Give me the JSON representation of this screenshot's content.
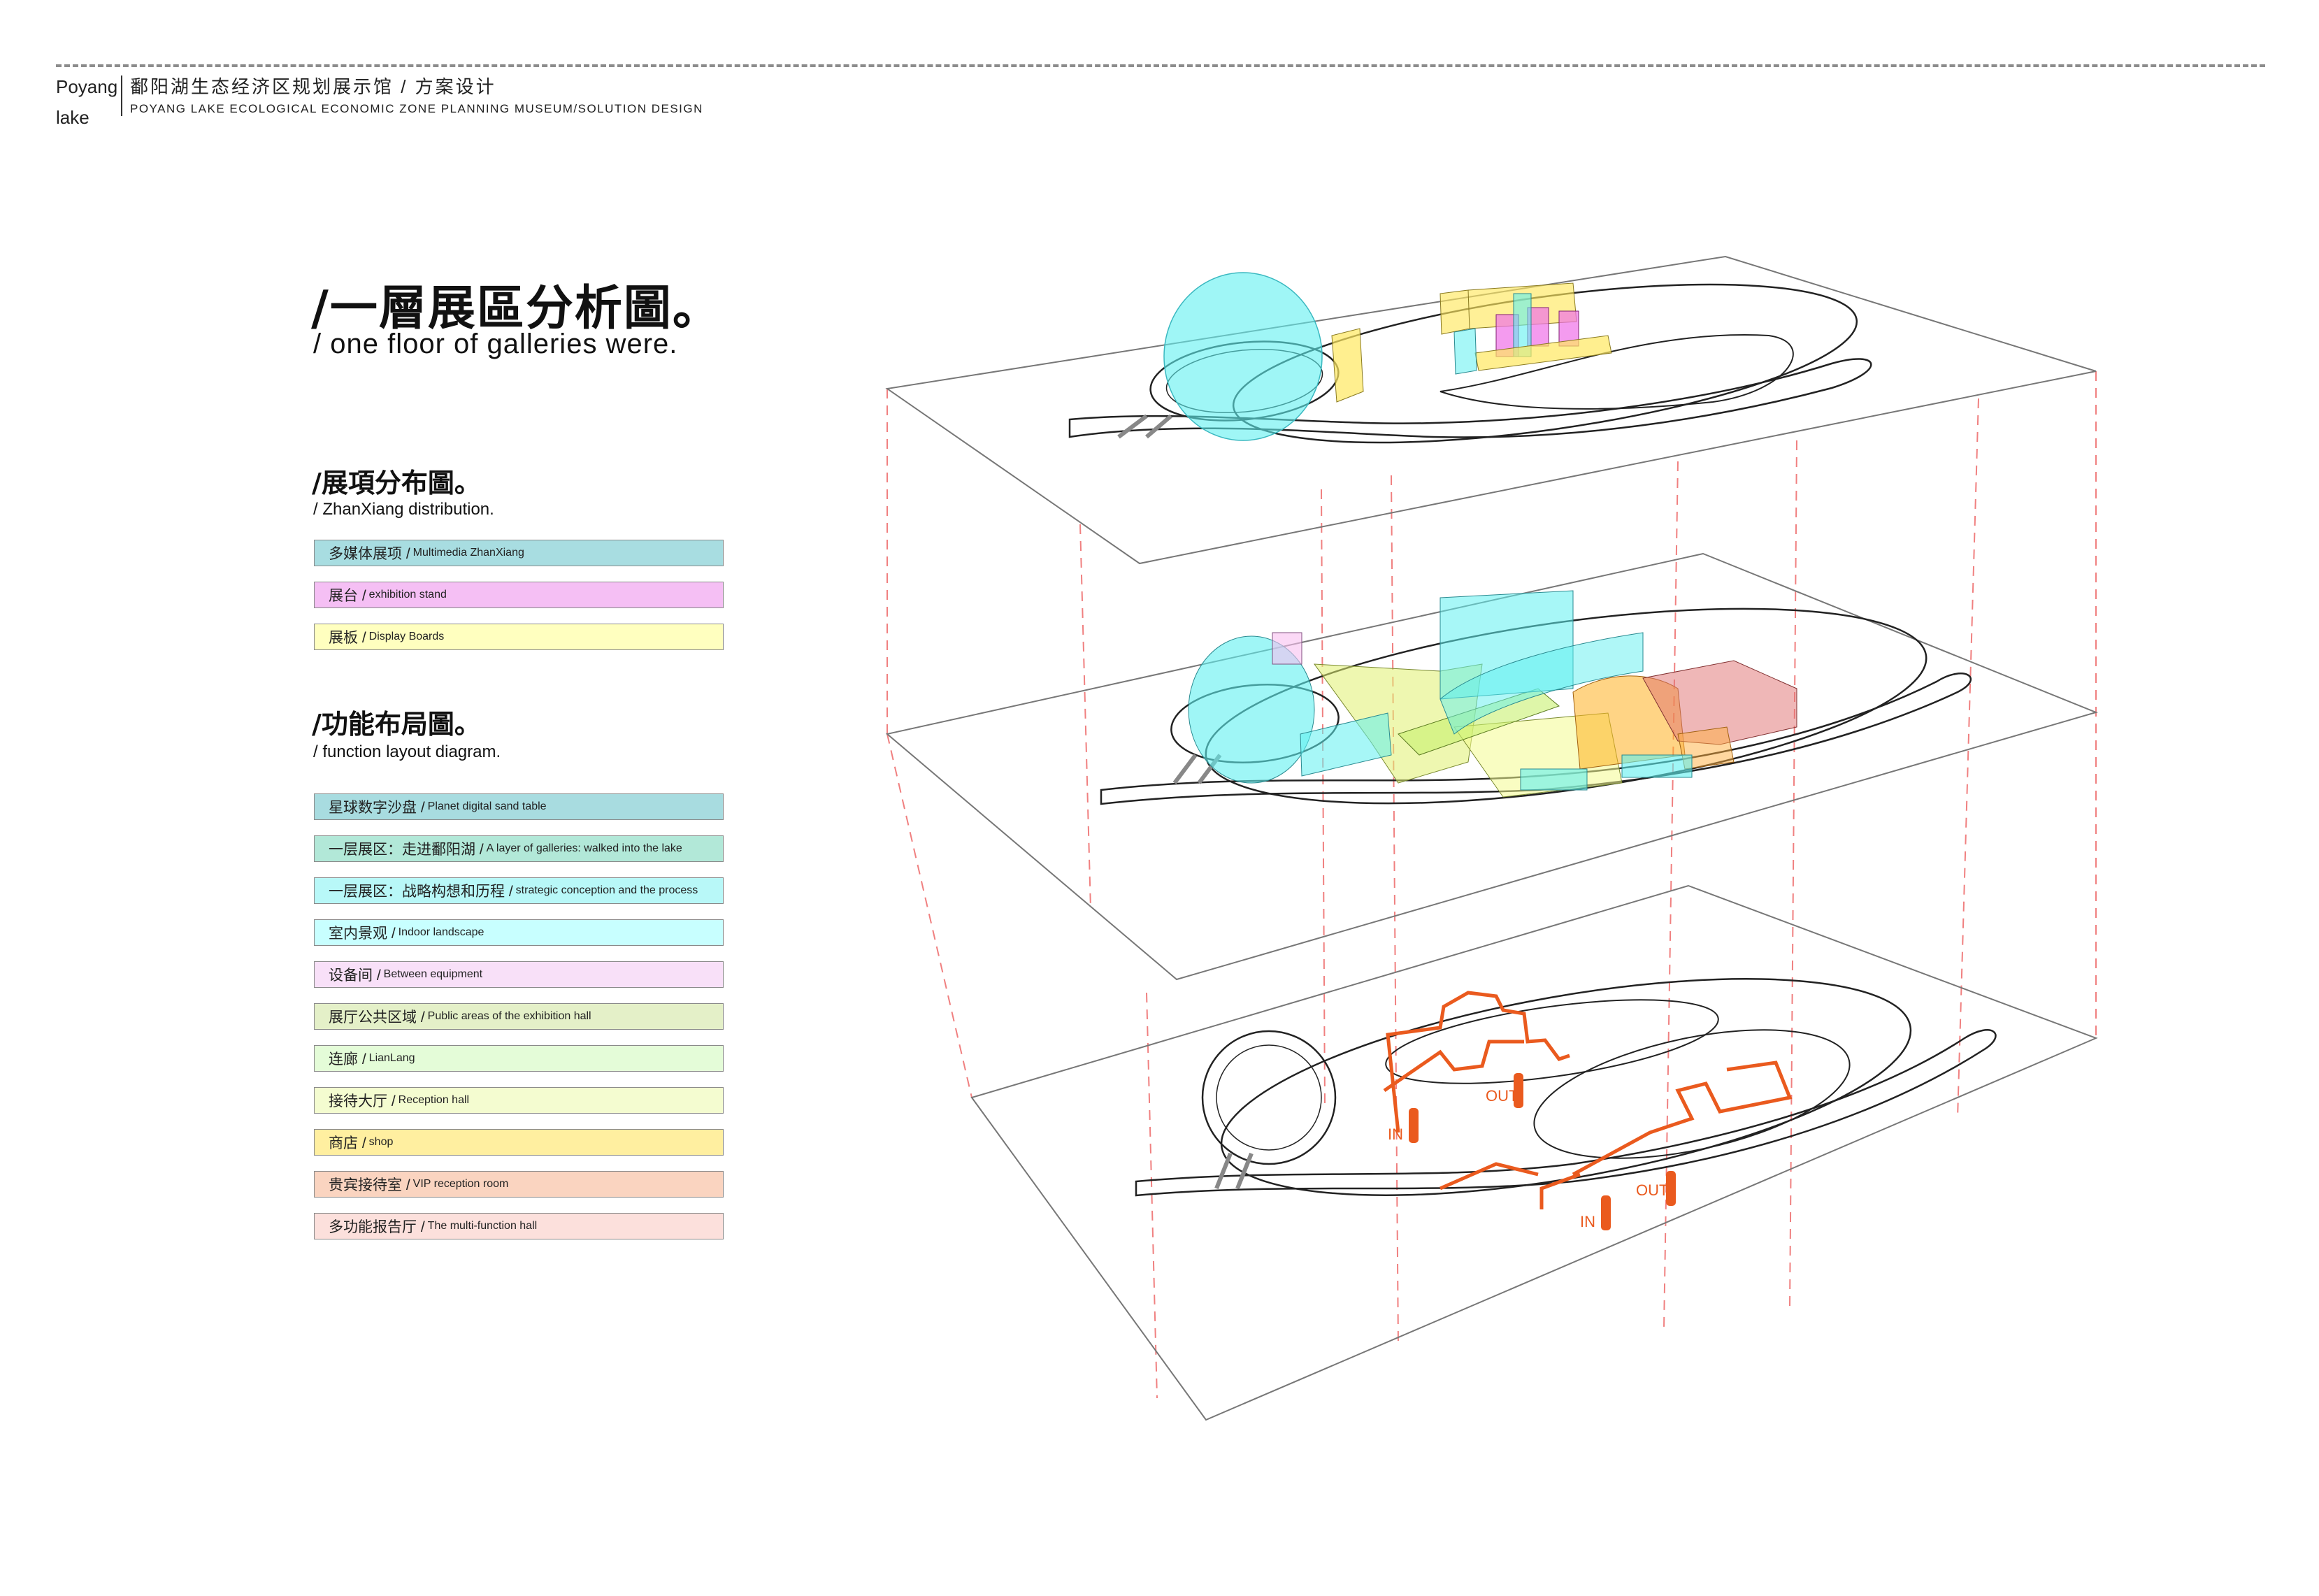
{
  "header": {
    "brand_line1": "Poyang",
    "brand_line2": "lake",
    "title_cn": "鄱阳湖生态经济区规划展示馆 / 方案设计",
    "title_en": "POYANG LAKE ECOLOGICAL ECONOMIC ZONE PLANNING MUSEUM/SOLUTION DESIGN"
  },
  "main_title": {
    "cn": "/一層展區分析圖。",
    "en": "/ one floor of galleries were."
  },
  "zhanxiang_section": {
    "title_cn": "/展項分布圖。",
    "title_en": "/ ZhanXiang distribution.",
    "items": [
      {
        "cn": "多媒体展项 /",
        "en": "Multimedia ZhanXiang",
        "color": "#A8DDE1"
      },
      {
        "cn": "展台 /",
        "en": "exhibition stand",
        "color": "#F5BFF4"
      },
      {
        "cn": "展板 /",
        "en": "Display Boards",
        "color": "#FFFFBF"
      }
    ]
  },
  "function_section": {
    "title_cn": "/功能布局圖。",
    "title_en": "/ function layout diagram.",
    "items": [
      {
        "cn": "星球数字沙盘 /",
        "en": "Planet digital sand table",
        "color": "#A8DCE0"
      },
      {
        "cn": "一层展区：走进鄱阳湖 /",
        "en": "A layer of galleries: walked into the lake",
        "color": "#B2E8D8"
      },
      {
        "cn": "一层展区：战略构想和历程 /",
        "en": "strategic conception and the process",
        "color": "#B8F8F8"
      },
      {
        "cn": "室内景观 /",
        "en": "Indoor landscape",
        "color": "#C8FFFF"
      },
      {
        "cn": "设备间 /",
        "en": "Between equipment",
        "color": "#F8E0F8"
      },
      {
        "cn": "展厅公共区域 /",
        "en": "Public areas of the exhibition hall",
        "color": "#E4F0C8"
      },
      {
        "cn": "连廊 /",
        "en": "LianLang",
        "color": "#E4FCD8"
      },
      {
        "cn": "接待大厅 /",
        "en": "Reception hall",
        "color": "#F4FCD0"
      },
      {
        "cn": "商店 /",
        "en": "shop",
        "color": "#FFEFA0"
      },
      {
        "cn": "贵宾接待室 /",
        "en": "VIP reception room",
        "color": "#FAD4C0"
      },
      {
        "cn": "多功能报告厅 /",
        "en": "The multi-function hall",
        "color": "#FCE0DC"
      }
    ]
  },
  "diagram": {
    "flow_labels": [
      "IN",
      "OUT",
      "OUT",
      "IN"
    ],
    "colors": {
      "multimedia": "#5FF0F0",
      "stand": "#F070E8",
      "board": "#FFE860",
      "public": "#E0F070",
      "shop": "#FFB020",
      "vip": "#E07070",
      "flow": "#EA5A1E",
      "guide": "#F08080"
    }
  }
}
